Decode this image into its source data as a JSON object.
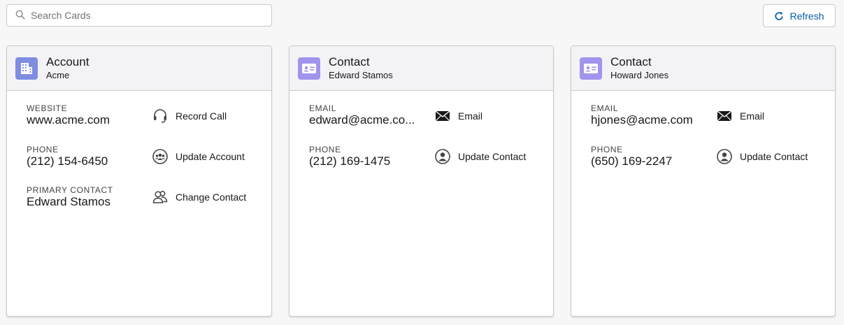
{
  "toolbar": {
    "search_placeholder": "Search Cards",
    "refresh_label": "Refresh"
  },
  "colors": {
    "account_icon_bg": "#7f8de1",
    "contact_icon_bg": "#a094ed",
    "brand_blue": "#0b5cab"
  },
  "cards": [
    {
      "title": "Account",
      "subtitle": "Acme",
      "icon": "building-icon",
      "fields": [
        {
          "label": "WEBSITE",
          "value": "www.acme.com"
        },
        {
          "label": "PHONE",
          "value": "(212) 154-6450"
        },
        {
          "label": "PRIMARY CONTACT",
          "value": "Edward Stamos"
        }
      ],
      "actions": [
        {
          "label": "Record Call",
          "icon": "headset-icon"
        },
        {
          "label": "Update Account",
          "icon": "people-icon"
        },
        {
          "label": "Change Contact",
          "icon": "user-switch-icon"
        }
      ]
    },
    {
      "title": "Contact",
      "subtitle": "Edward Stamos",
      "icon": "contact-card-icon",
      "fields": [
        {
          "label": "EMAIL",
          "value": "edward@acme.co..."
        },
        {
          "label": "PHONE",
          "value": "(212) 169-1475"
        }
      ],
      "actions": [
        {
          "label": "Email",
          "icon": "email-icon"
        },
        {
          "label": "Update Contact",
          "icon": "user-icon"
        }
      ]
    },
    {
      "title": "Contact",
      "subtitle": "Howard Jones",
      "icon": "contact-card-icon",
      "fields": [
        {
          "label": "EMAIL",
          "value": "hjones@acme.com"
        },
        {
          "label": "PHONE",
          "value": "(650) 169-2247"
        }
      ],
      "actions": [
        {
          "label": "Email",
          "icon": "email-icon"
        },
        {
          "label": "Update Contact",
          "icon": "user-icon"
        }
      ]
    }
  ]
}
